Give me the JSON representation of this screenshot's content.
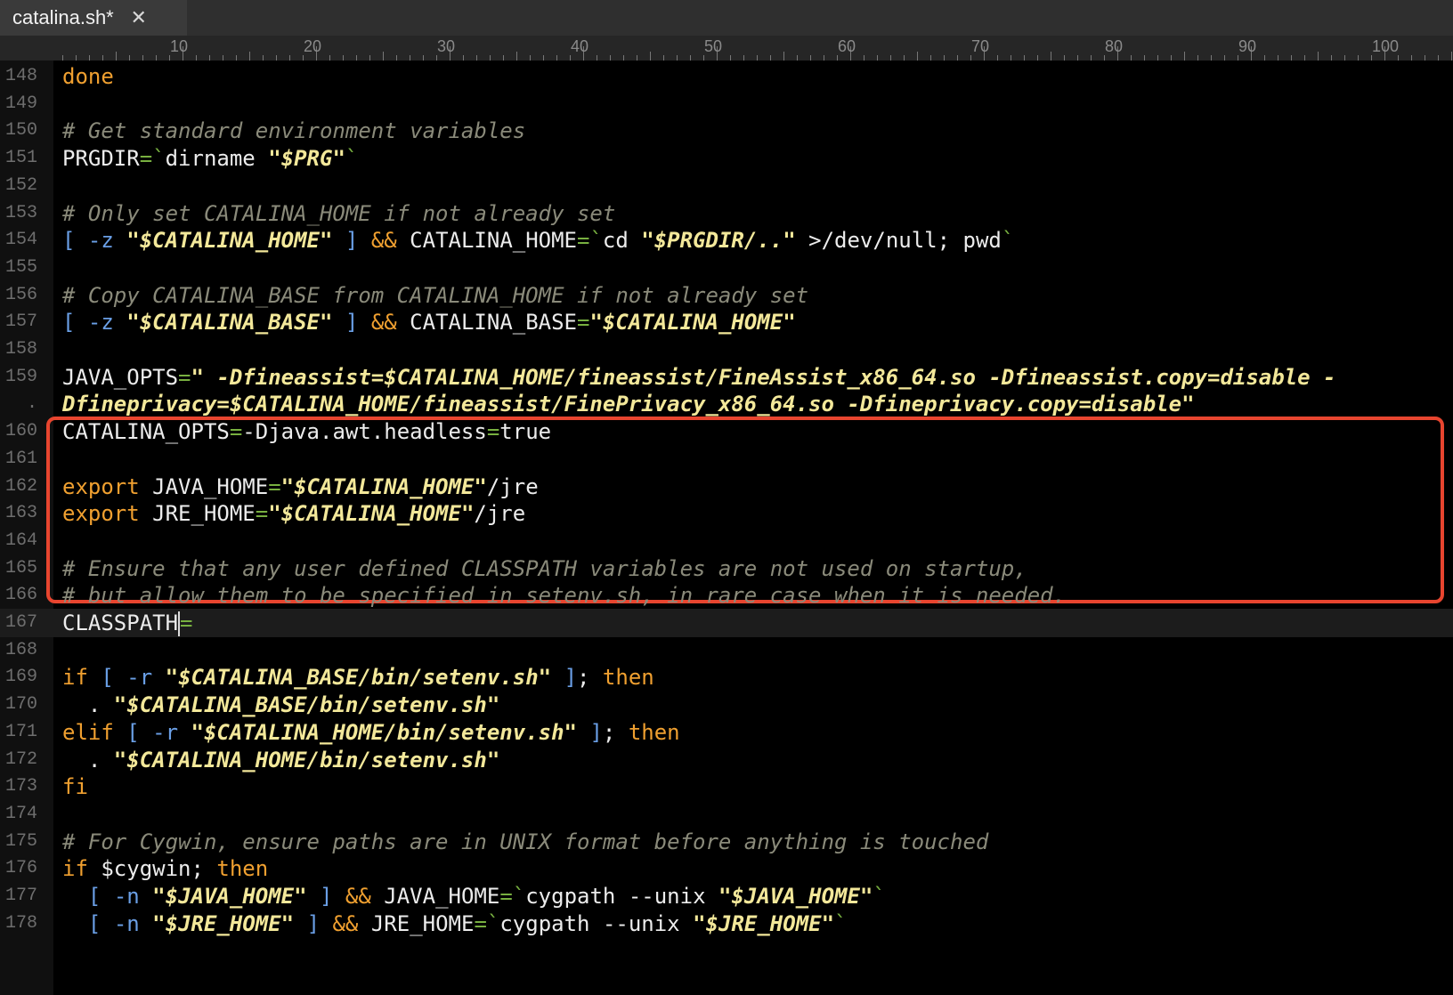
{
  "tab": {
    "title": "catalina.sh*",
    "close_glyph": "✕"
  },
  "ruler": {
    "labels": [
      "10",
      "20",
      "30",
      "40",
      "50",
      "60",
      "70",
      "80",
      "90",
      "100"
    ]
  },
  "colors": {
    "keyword": "#f0a030",
    "operator": "#78b040",
    "string": "#f3e89a",
    "comment": "#8a8a7a",
    "bracket": "#6a9fe6",
    "highlight": "#e8452f"
  },
  "lines": [
    {
      "n": "148",
      "tokens": [
        [
          "kw",
          "done"
        ]
      ]
    },
    {
      "n": "149",
      "tokens": []
    },
    {
      "n": "150",
      "tokens": [
        [
          "cm",
          "# Get standard environment variables"
        ]
      ]
    },
    {
      "n": "151",
      "tokens": [
        [
          "plain",
          "PRGDIR"
        ],
        [
          "op",
          "="
        ],
        [
          "op",
          "`"
        ],
        [
          "plain",
          "dirname "
        ],
        [
          "str",
          "\"$PRG\""
        ],
        [
          "op",
          "`"
        ]
      ]
    },
    {
      "n": "152",
      "tokens": []
    },
    {
      "n": "153",
      "tokens": [
        [
          "cm",
          "# Only set CATALINA_HOME if not already set"
        ]
      ]
    },
    {
      "n": "154",
      "tokens": [
        [
          "br",
          "["
        ],
        [
          "plain",
          " "
        ],
        [
          "fl",
          "-z"
        ],
        [
          "plain",
          " "
        ],
        [
          "str",
          "\"$CATALINA_HOME\""
        ],
        [
          "plain",
          " "
        ],
        [
          "br",
          "]"
        ],
        [
          "plain",
          " "
        ],
        [
          "kw",
          "&&"
        ],
        [
          "plain",
          " CATALINA_HOME"
        ],
        [
          "op",
          "="
        ],
        [
          "op",
          "`"
        ],
        [
          "plain",
          "cd "
        ],
        [
          "str",
          "\"$PRGDIR/..\""
        ],
        [
          "plain",
          " >/dev/null; pwd"
        ],
        [
          "op",
          "`"
        ]
      ]
    },
    {
      "n": "155",
      "tokens": []
    },
    {
      "n": "156",
      "tokens": [
        [
          "cm",
          "# Copy CATALINA_BASE from CATALINA_HOME if not already set"
        ]
      ]
    },
    {
      "n": "157",
      "tokens": [
        [
          "br",
          "["
        ],
        [
          "plain",
          " "
        ],
        [
          "fl",
          "-z"
        ],
        [
          "plain",
          " "
        ],
        [
          "str",
          "\"$CATALINA_BASE\""
        ],
        [
          "plain",
          " "
        ],
        [
          "br",
          "]"
        ],
        [
          "plain",
          " "
        ],
        [
          "kw",
          "&&"
        ],
        [
          "plain",
          " CATALINA_BASE"
        ],
        [
          "op",
          "="
        ],
        [
          "str",
          "\"$CATALINA_HOME\""
        ]
      ]
    },
    {
      "n": "158",
      "tokens": []
    },
    {
      "n": "159",
      "tokens": [
        [
          "plain",
          "JAVA_OPTS"
        ],
        [
          "op",
          "="
        ],
        [
          "str",
          "\" -Dfineassist=$CATALINA_HOME/fineassist/FineAssist_x86_64.so -Dfineassist.copy=disable -"
        ]
      ]
    },
    {
      "n": ".",
      "tokens": [
        [
          "str",
          "Dfineprivacy=$CATALINA_HOME/fineassist/FinePrivacy_x86_64.so -Dfineprivacy.copy=disable\""
        ]
      ]
    },
    {
      "n": "160",
      "tokens": [
        [
          "plain",
          "CATALINA_OPTS"
        ],
        [
          "op",
          "="
        ],
        [
          "plain",
          "-Djava.awt.headless"
        ],
        [
          "op",
          "="
        ],
        [
          "plain",
          "true"
        ]
      ]
    },
    {
      "n": "161",
      "tokens": []
    },
    {
      "n": "162",
      "tokens": [
        [
          "kw",
          "export"
        ],
        [
          "plain",
          " JAVA_HOME"
        ],
        [
          "op",
          "="
        ],
        [
          "str",
          "\"$CATALINA_HOME\""
        ],
        [
          "plain",
          "/jre"
        ]
      ]
    },
    {
      "n": "163",
      "tokens": [
        [
          "kw",
          "export"
        ],
        [
          "plain",
          " JRE_HOME"
        ],
        [
          "op",
          "="
        ],
        [
          "str",
          "\"$CATALINA_HOME\""
        ],
        [
          "plain",
          "/jre"
        ]
      ]
    },
    {
      "n": "164",
      "tokens": []
    },
    {
      "n": "165",
      "tokens": [
        [
          "cm",
          "# Ensure that any user defined CLASSPATH variables are not used on startup,"
        ]
      ]
    },
    {
      "n": "166",
      "tokens": [
        [
          "cm",
          "# but allow them to be specified in setenv.sh, in rare case when it is needed."
        ]
      ]
    },
    {
      "n": "167",
      "tokens": [
        [
          "plain",
          "CLASSPATH"
        ],
        [
          "caret",
          ""
        ],
        [
          "op",
          "="
        ]
      ],
      "current": true
    },
    {
      "n": "168",
      "tokens": []
    },
    {
      "n": "169",
      "tokens": [
        [
          "kw",
          "if"
        ],
        [
          "plain",
          " "
        ],
        [
          "br",
          "["
        ],
        [
          "plain",
          " "
        ],
        [
          "fl",
          "-r"
        ],
        [
          "plain",
          " "
        ],
        [
          "str",
          "\"$CATALINA_BASE/bin/setenv.sh\""
        ],
        [
          "plain",
          " "
        ],
        [
          "br",
          "]"
        ],
        [
          "plain",
          "; "
        ],
        [
          "kw",
          "then"
        ]
      ]
    },
    {
      "n": "170",
      "tokens": [
        [
          "plain",
          "  . "
        ],
        [
          "str",
          "\"$CATALINA_BASE/bin/setenv.sh\""
        ]
      ]
    },
    {
      "n": "171",
      "tokens": [
        [
          "kw",
          "elif"
        ],
        [
          "plain",
          " "
        ],
        [
          "br",
          "["
        ],
        [
          "plain",
          " "
        ],
        [
          "fl",
          "-r"
        ],
        [
          "plain",
          " "
        ],
        [
          "str",
          "\"$CATALINA_HOME/bin/setenv.sh\""
        ],
        [
          "plain",
          " "
        ],
        [
          "br",
          "]"
        ],
        [
          "plain",
          "; "
        ],
        [
          "kw",
          "then"
        ]
      ]
    },
    {
      "n": "172",
      "tokens": [
        [
          "plain",
          "  . "
        ],
        [
          "str",
          "\"$CATALINA_HOME/bin/setenv.sh\""
        ]
      ]
    },
    {
      "n": "173",
      "tokens": [
        [
          "kw",
          "fi"
        ]
      ]
    },
    {
      "n": "174",
      "tokens": []
    },
    {
      "n": "175",
      "tokens": [
        [
          "cm",
          "# For Cygwin, ensure paths are in UNIX format before anything is touched"
        ]
      ]
    },
    {
      "n": "176",
      "tokens": [
        [
          "kw",
          "if"
        ],
        [
          "plain",
          " $cygwin; "
        ],
        [
          "kw",
          "then"
        ]
      ]
    },
    {
      "n": "177",
      "tokens": [
        [
          "plain",
          "  "
        ],
        [
          "br",
          "["
        ],
        [
          "plain",
          " "
        ],
        [
          "fl",
          "-n"
        ],
        [
          "plain",
          " "
        ],
        [
          "str",
          "\"$JAVA_HOME\""
        ],
        [
          "plain",
          " "
        ],
        [
          "br",
          "]"
        ],
        [
          "plain",
          " "
        ],
        [
          "kw",
          "&&"
        ],
        [
          "plain",
          " JAVA_HOME"
        ],
        [
          "op",
          "="
        ],
        [
          "op",
          "`"
        ],
        [
          "plain",
          "cygpath --unix "
        ],
        [
          "str",
          "\"$JAVA_HOME\""
        ],
        [
          "op",
          "`"
        ]
      ]
    },
    {
      "n": "178",
      "tokens": [
        [
          "plain",
          "  "
        ],
        [
          "br",
          "["
        ],
        [
          "plain",
          " "
        ],
        [
          "fl",
          "-n"
        ],
        [
          "plain",
          " "
        ],
        [
          "str",
          "\"$JRE_HOME\""
        ],
        [
          "plain",
          " "
        ],
        [
          "br",
          "]"
        ],
        [
          "plain",
          " "
        ],
        [
          "kw",
          "&&"
        ],
        [
          "plain",
          " JRE_HOME"
        ],
        [
          "op",
          "="
        ],
        [
          "op",
          "`"
        ],
        [
          "plain",
          "cygpath --unix "
        ],
        [
          "str",
          "\"$JRE_HOME\""
        ],
        [
          "op",
          "`"
        ]
      ]
    }
  ]
}
